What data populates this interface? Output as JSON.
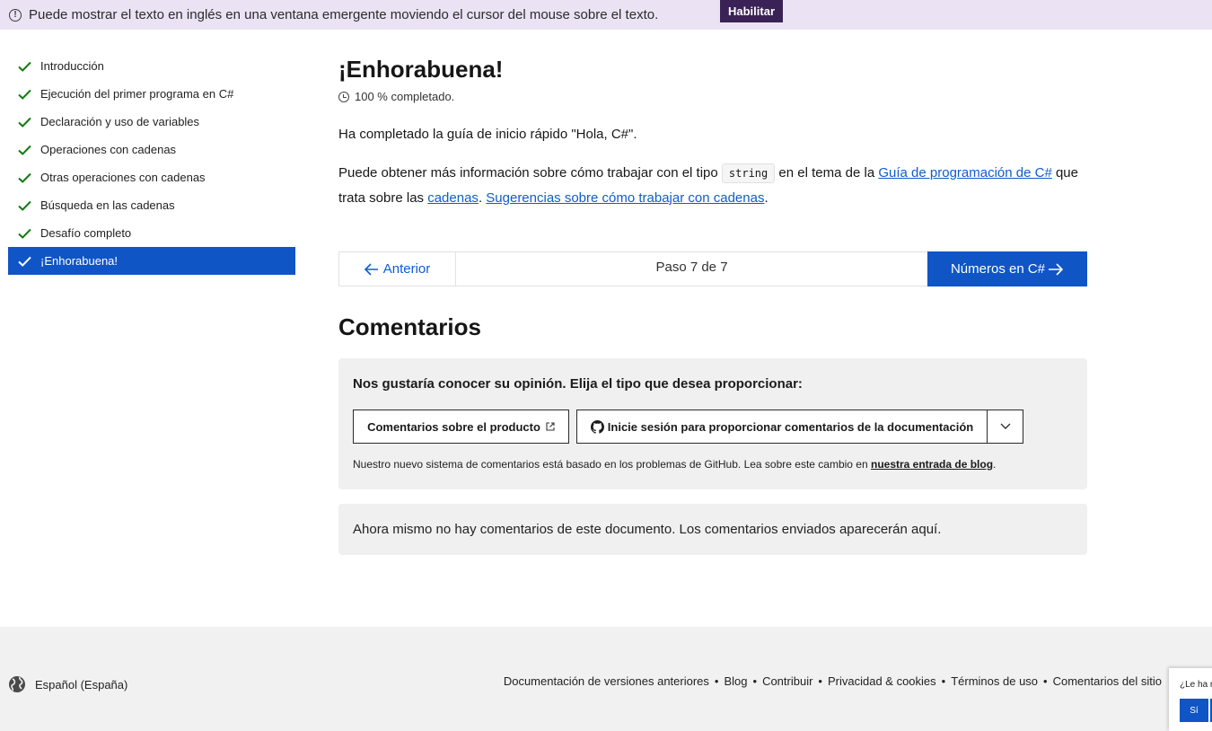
{
  "banner": {
    "icon": "info-circle-icon",
    "text": "Puede mostrar el texto en inglés en una ventana emergente moviendo el cursor del mouse sobre el texto.",
    "button_label": "Habilitar"
  },
  "sidebar": {
    "items": [
      {
        "label": "Introducción",
        "done": true
      },
      {
        "label": "Ejecución del primer programa en C#",
        "done": true
      },
      {
        "label": "Declaración y uso de variables",
        "done": true
      },
      {
        "label": "Operaciones con cadenas",
        "done": true
      },
      {
        "label": "Otras operaciones con cadenas",
        "done": true
      },
      {
        "label": "Búsqueda en las cadenas",
        "done": true
      },
      {
        "label": "Desafío completo",
        "done": true
      },
      {
        "label": "¡Enhorabuena!",
        "done": true,
        "active": true
      }
    ]
  },
  "main": {
    "title": "¡Enhorabuena!",
    "progress": "100 % completado.",
    "p1": "Ha completado la guía de inicio rápido \"Hola, C#\".",
    "p2": {
      "t1": "Puede obtener más información sobre cómo trabajar con el tipo ",
      "code": "string",
      "t2": " en el tema de la ",
      "link1": "Guía de programación de C#",
      "t3": " que trata sobre las ",
      "link2": "cadenas",
      "t4": ". ",
      "link3": "Sugerencias sobre cómo trabajar con cadenas",
      "t5": "."
    }
  },
  "pager": {
    "prev": "Anterior",
    "step": "Paso 7 de 7",
    "next": "Números en C#"
  },
  "feedback": {
    "heading": "Comentarios",
    "question": "Nos gustaría conocer su opinión. Elija el tipo que desea proporcionar:",
    "product_button": "Comentarios sobre el producto",
    "docs_button": "Inicie sesión para proporcionar comentarios de la documentación",
    "note": "Nuestro nuevo sistema de comentarios está basado en los problemas de GitHub. Lea sobre este cambio en ",
    "note_link": "nuestra entrada de blog",
    "note_end": ".",
    "no_comments": "Ahora mismo no hay comentarios de este documento. Los comentarios enviados aparecerán aquí."
  },
  "footer": {
    "locale": "Español (España)",
    "links": [
      "Documentación de versiones anteriores",
      "Blog",
      "Contribuir",
      "Privacidad & cookies",
      "Términos de uso",
      "Comentarios del sitio"
    ]
  },
  "popup": {
    "question": "¿Le ha r",
    "yes": "Sí"
  },
  "colors": {
    "accent": "#0f55c5",
    "banner_bg": "#ebe3f4",
    "banner_button": "#3b2256",
    "check": "#107c10"
  }
}
